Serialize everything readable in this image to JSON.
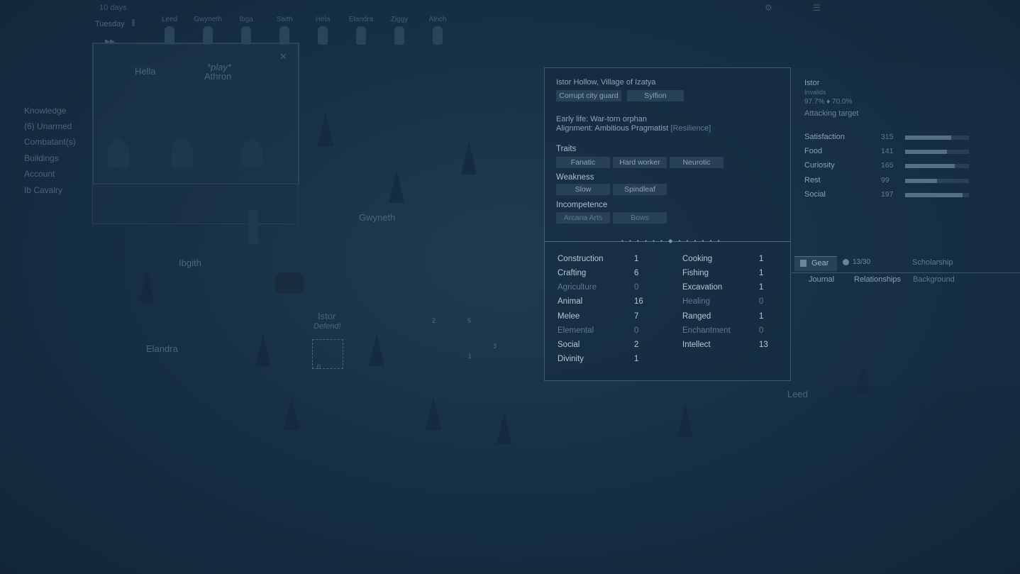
{
  "topbar": {
    "days": "10 days",
    "weekday": "Tuesday"
  },
  "colonists": [
    "Leed",
    "Gwyneth",
    "Ibga",
    "Saith",
    "Hela",
    "Elandra",
    "Ziggy",
    "Alrich"
  ],
  "left_items": [
    "Knowledge",
    "(6) Unarmed",
    "Combatant(s)",
    "Buildings",
    "Account",
    "Ib Cavalry"
  ],
  "map": {
    "room_names": [
      "Hella",
      "Athron"
    ],
    "room_status": "*play*",
    "characters": [
      "Gwyneth",
      "Ibgith",
      "Elandra",
      "Istor",
      "Leed"
    ],
    "istor_status": "Defend!",
    "nums": [
      "2",
      "5",
      "3",
      "1",
      "0"
    ]
  },
  "panel": {
    "location": "Istor Hollow, Village of Izatya",
    "title_tags": [
      "Corrupt city guard",
      "Sylfion"
    ],
    "early_life": "Early life: War-torn orphan",
    "alignment": "Alignment: Ambitious Pragmatist",
    "alignment_extra": "Resilience",
    "traits_label": "Traits",
    "traits": [
      "Fanatic",
      "Hard worker",
      "Neurotic"
    ],
    "weakness_label": "Weakness",
    "weakness": [
      "Slow",
      "Spindleaf"
    ],
    "incompetence_label": "Incompetence",
    "incompetence": [
      "Arcana Arts",
      "Bows"
    ]
  },
  "skills_left": [
    {
      "name": "Construction",
      "value": "1",
      "weak": false
    },
    {
      "name": "Crafting",
      "value": "6",
      "weak": false
    },
    {
      "name": "Agriculture",
      "value": "0",
      "weak": true
    },
    {
      "name": "Animal",
      "value": "16",
      "weak": false
    },
    {
      "name": "Melee",
      "value": "7",
      "weak": false
    },
    {
      "name": "Elemental",
      "value": "0",
      "weak": true
    },
    {
      "name": "Social",
      "value": "2",
      "weak": false
    },
    {
      "name": "Divinity",
      "value": "1",
      "weak": false
    }
  ],
  "skills_right": [
    {
      "name": "Cooking",
      "value": "1",
      "weak": false
    },
    {
      "name": "Fishing",
      "value": "1",
      "weak": false
    },
    {
      "name": "Excavation",
      "value": "1",
      "weak": false
    },
    {
      "name": "Healing",
      "value": "0",
      "weak": true
    },
    {
      "name": "Ranged",
      "value": "1",
      "weak": false
    },
    {
      "name": "Enchantment",
      "value": "0",
      "weak": true
    },
    {
      "name": "Intellect",
      "value": "13",
      "weak": false
    }
  ],
  "right": {
    "name": "Istor",
    "sub": "Invalids",
    "stats": "97.7%  ♦  70.0%",
    "activity": "Attacking target",
    "needs": [
      {
        "name": "Satisfaction",
        "value": "315",
        "level": 0.72
      },
      {
        "name": "Food",
        "value": "141",
        "level": 0.65
      },
      {
        "name": "Curiosity",
        "value": "165",
        "level": 0.78
      },
      {
        "name": "Rest",
        "value": "99",
        "level": 0.5
      },
      {
        "name": "Social",
        "value": "197",
        "level": 0.9
      }
    ],
    "gear_label": "Gear",
    "load": "13/30",
    "scholar": "Scholarship",
    "tabs": [
      "Journal",
      "Relationships",
      "Background"
    ]
  },
  "colors": {
    "panel_bg": "#16304a",
    "accent": "#aebfce"
  }
}
